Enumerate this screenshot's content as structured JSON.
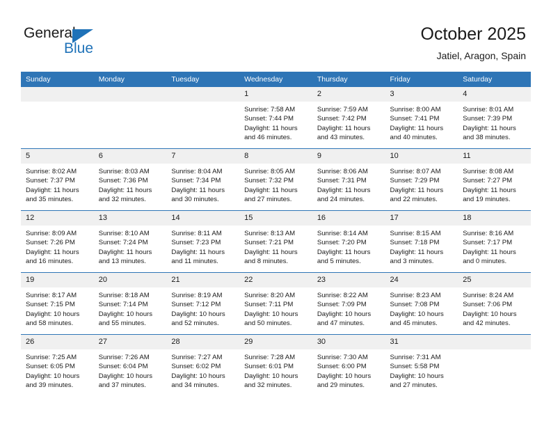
{
  "brand": {
    "line1": "General",
    "line2": "Blue",
    "flag_icon": "triangle-flag-icon",
    "accent_color": "#1f72b8"
  },
  "header": {
    "title": "October 2025",
    "subtitle": "Jatiel, Aragon, Spain"
  },
  "colors": {
    "header_bar": "#2e75b6",
    "daynum_band": "#f0f0f0",
    "text": "#1a1a1a"
  },
  "weekdays": [
    "Sunday",
    "Monday",
    "Tuesday",
    "Wednesday",
    "Thursday",
    "Friday",
    "Saturday"
  ],
  "weeks": [
    [
      {
        "day": "",
        "empty": true
      },
      {
        "day": "",
        "empty": true
      },
      {
        "day": "",
        "empty": true
      },
      {
        "day": "1",
        "sunrise": "Sunrise: 7:58 AM",
        "sunset": "Sunset: 7:44 PM",
        "daylight1": "Daylight: 11 hours",
        "daylight2": "and 46 minutes."
      },
      {
        "day": "2",
        "sunrise": "Sunrise: 7:59 AM",
        "sunset": "Sunset: 7:42 PM",
        "daylight1": "Daylight: 11 hours",
        "daylight2": "and 43 minutes."
      },
      {
        "day": "3",
        "sunrise": "Sunrise: 8:00 AM",
        "sunset": "Sunset: 7:41 PM",
        "daylight1": "Daylight: 11 hours",
        "daylight2": "and 40 minutes."
      },
      {
        "day": "4",
        "sunrise": "Sunrise: 8:01 AM",
        "sunset": "Sunset: 7:39 PM",
        "daylight1": "Daylight: 11 hours",
        "daylight2": "and 38 minutes."
      }
    ],
    [
      {
        "day": "5",
        "sunrise": "Sunrise: 8:02 AM",
        "sunset": "Sunset: 7:37 PM",
        "daylight1": "Daylight: 11 hours",
        "daylight2": "and 35 minutes."
      },
      {
        "day": "6",
        "sunrise": "Sunrise: 8:03 AM",
        "sunset": "Sunset: 7:36 PM",
        "daylight1": "Daylight: 11 hours",
        "daylight2": "and 32 minutes."
      },
      {
        "day": "7",
        "sunrise": "Sunrise: 8:04 AM",
        "sunset": "Sunset: 7:34 PM",
        "daylight1": "Daylight: 11 hours",
        "daylight2": "and 30 minutes."
      },
      {
        "day": "8",
        "sunrise": "Sunrise: 8:05 AM",
        "sunset": "Sunset: 7:32 PM",
        "daylight1": "Daylight: 11 hours",
        "daylight2": "and 27 minutes."
      },
      {
        "day": "9",
        "sunrise": "Sunrise: 8:06 AM",
        "sunset": "Sunset: 7:31 PM",
        "daylight1": "Daylight: 11 hours",
        "daylight2": "and 24 minutes."
      },
      {
        "day": "10",
        "sunrise": "Sunrise: 8:07 AM",
        "sunset": "Sunset: 7:29 PM",
        "daylight1": "Daylight: 11 hours",
        "daylight2": "and 22 minutes."
      },
      {
        "day": "11",
        "sunrise": "Sunrise: 8:08 AM",
        "sunset": "Sunset: 7:27 PM",
        "daylight1": "Daylight: 11 hours",
        "daylight2": "and 19 minutes."
      }
    ],
    [
      {
        "day": "12",
        "sunrise": "Sunrise: 8:09 AM",
        "sunset": "Sunset: 7:26 PM",
        "daylight1": "Daylight: 11 hours",
        "daylight2": "and 16 minutes."
      },
      {
        "day": "13",
        "sunrise": "Sunrise: 8:10 AM",
        "sunset": "Sunset: 7:24 PM",
        "daylight1": "Daylight: 11 hours",
        "daylight2": "and 13 minutes."
      },
      {
        "day": "14",
        "sunrise": "Sunrise: 8:11 AM",
        "sunset": "Sunset: 7:23 PM",
        "daylight1": "Daylight: 11 hours",
        "daylight2": "and 11 minutes."
      },
      {
        "day": "15",
        "sunrise": "Sunrise: 8:13 AM",
        "sunset": "Sunset: 7:21 PM",
        "daylight1": "Daylight: 11 hours",
        "daylight2": "and 8 minutes."
      },
      {
        "day": "16",
        "sunrise": "Sunrise: 8:14 AM",
        "sunset": "Sunset: 7:20 PM",
        "daylight1": "Daylight: 11 hours",
        "daylight2": "and 5 minutes."
      },
      {
        "day": "17",
        "sunrise": "Sunrise: 8:15 AM",
        "sunset": "Sunset: 7:18 PM",
        "daylight1": "Daylight: 11 hours",
        "daylight2": "and 3 minutes."
      },
      {
        "day": "18",
        "sunrise": "Sunrise: 8:16 AM",
        "sunset": "Sunset: 7:17 PM",
        "daylight1": "Daylight: 11 hours",
        "daylight2": "and 0 minutes."
      }
    ],
    [
      {
        "day": "19",
        "sunrise": "Sunrise: 8:17 AM",
        "sunset": "Sunset: 7:15 PM",
        "daylight1": "Daylight: 10 hours",
        "daylight2": "and 58 minutes."
      },
      {
        "day": "20",
        "sunrise": "Sunrise: 8:18 AM",
        "sunset": "Sunset: 7:14 PM",
        "daylight1": "Daylight: 10 hours",
        "daylight2": "and 55 minutes."
      },
      {
        "day": "21",
        "sunrise": "Sunrise: 8:19 AM",
        "sunset": "Sunset: 7:12 PM",
        "daylight1": "Daylight: 10 hours",
        "daylight2": "and 52 minutes."
      },
      {
        "day": "22",
        "sunrise": "Sunrise: 8:20 AM",
        "sunset": "Sunset: 7:11 PM",
        "daylight1": "Daylight: 10 hours",
        "daylight2": "and 50 minutes."
      },
      {
        "day": "23",
        "sunrise": "Sunrise: 8:22 AM",
        "sunset": "Sunset: 7:09 PM",
        "daylight1": "Daylight: 10 hours",
        "daylight2": "and 47 minutes."
      },
      {
        "day": "24",
        "sunrise": "Sunrise: 8:23 AM",
        "sunset": "Sunset: 7:08 PM",
        "daylight1": "Daylight: 10 hours",
        "daylight2": "and 45 minutes."
      },
      {
        "day": "25",
        "sunrise": "Sunrise: 8:24 AM",
        "sunset": "Sunset: 7:06 PM",
        "daylight1": "Daylight: 10 hours",
        "daylight2": "and 42 minutes."
      }
    ],
    [
      {
        "day": "26",
        "sunrise": "Sunrise: 7:25 AM",
        "sunset": "Sunset: 6:05 PM",
        "daylight1": "Daylight: 10 hours",
        "daylight2": "and 39 minutes."
      },
      {
        "day": "27",
        "sunrise": "Sunrise: 7:26 AM",
        "sunset": "Sunset: 6:04 PM",
        "daylight1": "Daylight: 10 hours",
        "daylight2": "and 37 minutes."
      },
      {
        "day": "28",
        "sunrise": "Sunrise: 7:27 AM",
        "sunset": "Sunset: 6:02 PM",
        "daylight1": "Daylight: 10 hours",
        "daylight2": "and 34 minutes."
      },
      {
        "day": "29",
        "sunrise": "Sunrise: 7:28 AM",
        "sunset": "Sunset: 6:01 PM",
        "daylight1": "Daylight: 10 hours",
        "daylight2": "and 32 minutes."
      },
      {
        "day": "30",
        "sunrise": "Sunrise: 7:30 AM",
        "sunset": "Sunset: 6:00 PM",
        "daylight1": "Daylight: 10 hours",
        "daylight2": "and 29 minutes."
      },
      {
        "day": "31",
        "sunrise": "Sunrise: 7:31 AM",
        "sunset": "Sunset: 5:58 PM",
        "daylight1": "Daylight: 10 hours",
        "daylight2": "and 27 minutes."
      },
      {
        "day": "",
        "empty": true
      }
    ]
  ]
}
